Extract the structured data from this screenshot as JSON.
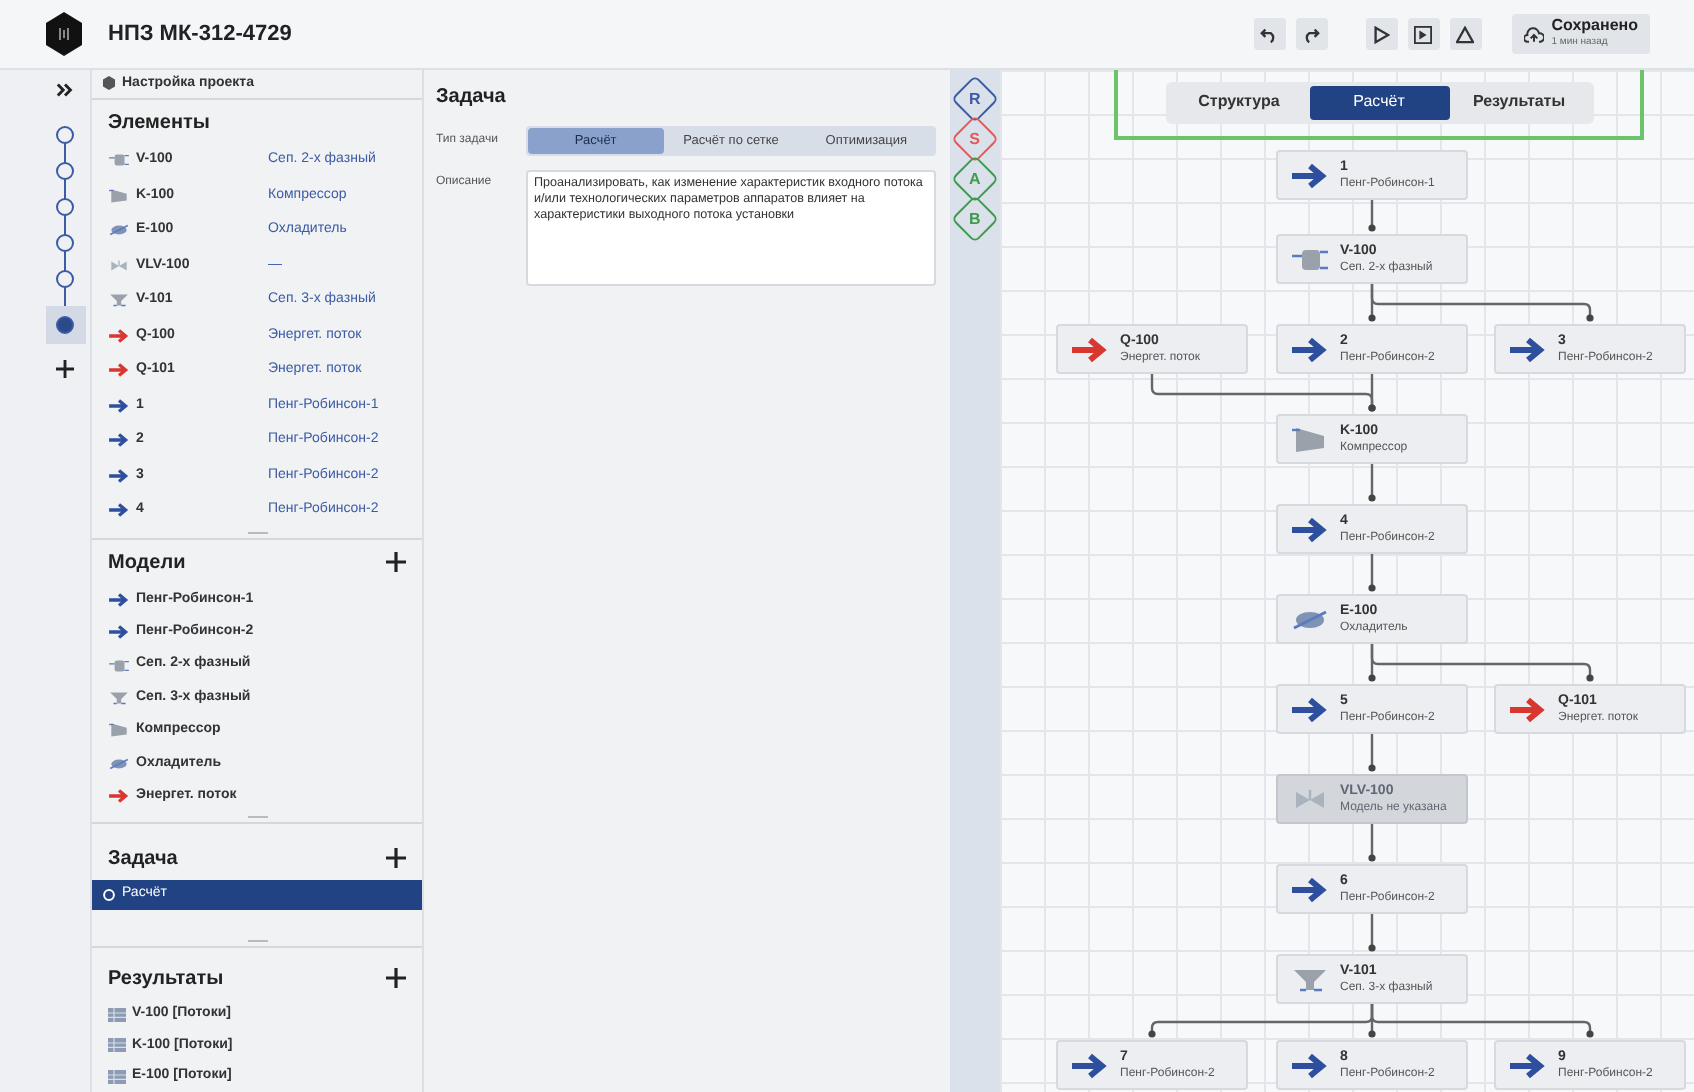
{
  "header": {
    "title": "НПЗ МК-312-4729",
    "saved": {
      "label": "Сохранено",
      "time": "1 мин назад"
    }
  },
  "stepper": {
    "steps": [
      {
        "selected": false
      },
      {
        "selected": false
      },
      {
        "selected": false
      },
      {
        "selected": false
      },
      {
        "selected": false
      },
      {
        "selected": true
      }
    ]
  },
  "sidebar": {
    "project_settings": "Настройка проекта",
    "elements": {
      "title": "Элементы",
      "items": [
        {
          "kind": "separator2",
          "name": "V-100",
          "model": "Сеп. 2-х фазный"
        },
        {
          "kind": "compressor",
          "name": "K-100",
          "model": "Компрессор"
        },
        {
          "kind": "cooler",
          "name": "E-100",
          "model": "Охладитель"
        },
        {
          "kind": "valve",
          "name": "VLV-100",
          "model": "—"
        },
        {
          "kind": "separator3",
          "name": "V-101",
          "model": "Сеп. 3-х фазный"
        },
        {
          "kind": "energy",
          "name": "Q-100",
          "model": "Энергет. поток"
        },
        {
          "kind": "energy",
          "name": "Q-101",
          "model": "Энергет. поток"
        },
        {
          "kind": "stream",
          "name": "1",
          "model": "Пенг-Робинсон-1"
        },
        {
          "kind": "stream",
          "name": "2",
          "model": "Пенг-Робинсон-2"
        },
        {
          "kind": "stream",
          "name": "3",
          "model": "Пенг-Робинсон-2"
        },
        {
          "kind": "stream",
          "name": "4",
          "model": "Пенг-Робинсон-2"
        }
      ]
    },
    "models": {
      "title": "Модели",
      "items": [
        {
          "kind": "stream",
          "name": "Пенг-Робинсон-1"
        },
        {
          "kind": "stream",
          "name": "Пенг-Робинсон-2"
        },
        {
          "kind": "separator2",
          "name": "Сеп. 2-х фазный"
        },
        {
          "kind": "separator3",
          "name": "Сеп. 3-х фазный"
        },
        {
          "kind": "compressor",
          "name": "Компрессор"
        },
        {
          "kind": "cooler",
          "name": "Охладитель"
        },
        {
          "kind": "energy",
          "name": "Энергет. поток"
        }
      ]
    },
    "tasks": {
      "title": "Задача",
      "items": [
        {
          "name": "Расчёт",
          "selected": true
        }
      ]
    },
    "results": {
      "title": "Результаты",
      "items": [
        {
          "name": "V-100 [Потоки]"
        },
        {
          "name": "K-100 [Потоки]"
        },
        {
          "name": "E-100 [Потоки]"
        }
      ]
    }
  },
  "task": {
    "title": "Задача",
    "type_label": "Тип задачи",
    "types": [
      {
        "label": "Расчёт",
        "selected": true
      },
      {
        "label": "Расчёт по сетке",
        "selected": false
      },
      {
        "label": "Оптимизация",
        "selected": false
      }
    ],
    "description_label": "Описание",
    "description": "Проанализировать, как изменение характеристик входного потока и/или технологических параметров аппаратов влияет на характеристики выходного потока установки"
  },
  "tools": [
    {
      "letter": "R",
      "color": "#3b5ba5"
    },
    {
      "letter": "S",
      "color": "#e05a5a"
    },
    {
      "letter": "A",
      "color": "#3f9a4e"
    },
    {
      "letter": "B",
      "color": "#3f9a4e"
    }
  ],
  "view_tabs": [
    {
      "label": "Структура",
      "selected": false
    },
    {
      "label": "Расчёт",
      "selected": true
    },
    {
      "label": "Результаты",
      "selected": false
    }
  ],
  "diagram": {
    "rows": [
      {
        "center": {
          "kind": "stream",
          "name": "1",
          "model": "Пенг-Робинсон-1",
          "disabled": false
        }
      },
      {
        "center": {
          "kind": "separator2",
          "name": "V-100",
          "model": "Сеп. 2-х фазный",
          "disabled": false
        }
      },
      {
        "left": {
          "kind": "energy",
          "name": "Q-100",
          "model": "Энергет. поток",
          "disabled": false,
          "input": true
        },
        "center": {
          "kind": "stream",
          "name": "2",
          "model": "Пенг-Робинсон-2",
          "disabled": false
        },
        "right": {
          "kind": "stream",
          "name": "3",
          "model": "Пенг-Робинсон-2",
          "disabled": false
        }
      },
      {
        "center": {
          "kind": "compressor",
          "name": "K-100",
          "model": "Компрессор",
          "disabled": false
        }
      },
      {
        "center": {
          "kind": "stream",
          "name": "4",
          "model": "Пенг-Робинсон-2",
          "disabled": false
        }
      },
      {
        "center": {
          "kind": "cooler",
          "name": "E-100",
          "model": "Охладитель",
          "disabled": false
        }
      },
      {
        "center": {
          "kind": "stream",
          "name": "5",
          "model": "Пенг-Робинсон-2",
          "disabled": false
        },
        "right": {
          "kind": "energy",
          "name": "Q-101",
          "model": "Энергет. поток",
          "disabled": false
        }
      },
      {
        "center": {
          "kind": "valve",
          "name": "VLV-100",
          "model": "Модель не указана",
          "disabled": true
        }
      },
      {
        "center": {
          "kind": "stream",
          "name": "6",
          "model": "Пенг-Робинсон-2",
          "disabled": false
        }
      },
      {
        "center": {
          "kind": "separator3",
          "name": "V-101",
          "model": "Сеп. 3-х фазный",
          "disabled": false
        }
      },
      {
        "left": {
          "kind": "stream",
          "name": "7",
          "model": "Пенг-Робинсон-2",
          "disabled": false
        },
        "center": {
          "kind": "stream",
          "name": "8",
          "model": "Пенг-Робинсон-2",
          "disabled": false
        },
        "right": {
          "kind": "stream",
          "name": "9",
          "model": "Пенг-Робинсон-2",
          "disabled": false
        }
      }
    ]
  }
}
